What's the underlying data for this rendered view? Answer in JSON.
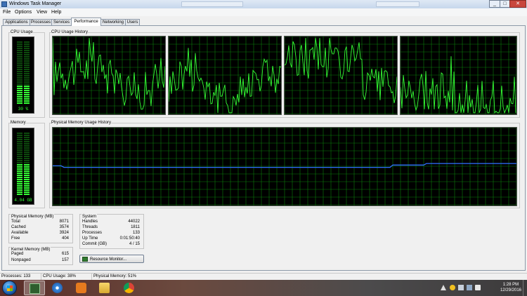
{
  "window": {
    "title": "Windows Task Manager",
    "controls": [
      "_",
      "□",
      "✕"
    ]
  },
  "menu": [
    "File",
    "Options",
    "View",
    "Help"
  ],
  "tabs": [
    {
      "label": "Applications",
      "active": false
    },
    {
      "label": "Processes",
      "active": false
    },
    {
      "label": "Services",
      "active": false
    },
    {
      "label": "Performance",
      "active": true
    },
    {
      "label": "Networking",
      "active": false
    },
    {
      "label": "Users",
      "active": false
    }
  ],
  "performance": {
    "cpu_usage_label": "CPU Usage",
    "cpu_usage_value": "30 %",
    "cpu_history_label": "CPU Usage History",
    "memory_label": "Memory",
    "memory_value": "4.04 GB",
    "memory_history_label": "Physical Memory Usage History",
    "cpu_fraction": 0.3,
    "memory_fraction": 0.51,
    "history_color": "#35ff35",
    "memory_line_color": "#2f6fff",
    "grid_color": "#0b7d0b"
  },
  "physical_memory": {
    "title": "Physical Memory (MB)",
    "rows": [
      {
        "label": "Total",
        "value": "8071"
      },
      {
        "label": "Cached",
        "value": "3574"
      },
      {
        "label": "Available",
        "value": "3924"
      },
      {
        "label": "Free",
        "value": "404"
      }
    ]
  },
  "kernel_memory": {
    "title": "Kernel Memory (MB)",
    "rows": [
      {
        "label": "Paged",
        "value": "615"
      },
      {
        "label": "Nonpaged",
        "value": "157"
      }
    ]
  },
  "system": {
    "title": "System",
    "rows": [
      {
        "label": "Handles",
        "value": "44022"
      },
      {
        "label": "Threads",
        "value": "1811"
      },
      {
        "label": "Processes",
        "value": "133"
      },
      {
        "label": "Up Time",
        "value": "0:01:50:40"
      },
      {
        "label": "Commit (GB)",
        "value": "4 / 15"
      }
    ]
  },
  "resource_monitor_button": "Resource Monitor...",
  "status": {
    "processes": "Processes: 133",
    "cpu": "CPU Usage: 38%",
    "memory": "Physical Memory: 51%"
  },
  "taskbar": {
    "apps": [
      "task-manager",
      "network",
      "media-player",
      "file-explorer",
      "chrome"
    ],
    "time": "1:28 PM",
    "date": "12/29/2016"
  }
}
